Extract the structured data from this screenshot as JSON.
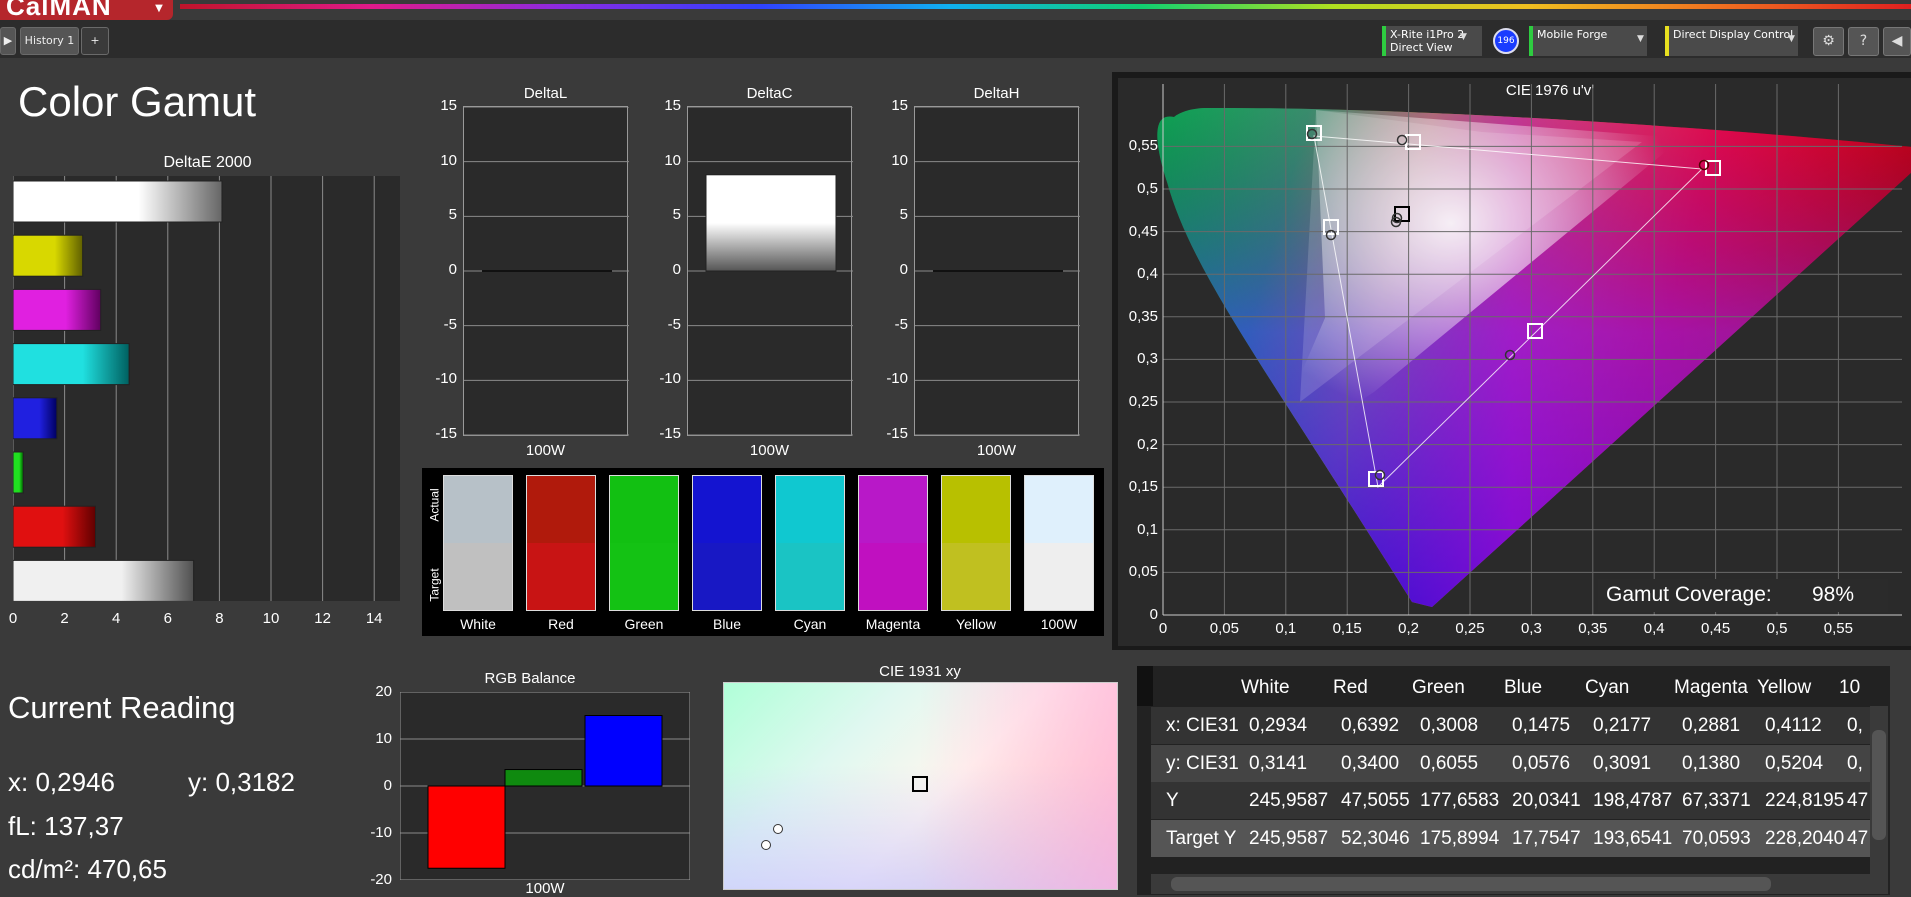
{
  "app": {
    "logo": "CalMAN",
    "logo_menu_icon": "chevron-down-icon"
  },
  "tabs": [
    {
      "label": "History 1"
    }
  ],
  "toolbar": {
    "meter_line1": "X-Rite i1Pro 2",
    "meter_line2": "Direct View",
    "meter_badge": "196",
    "source": "Mobile Forge",
    "display": "Direct Display Control"
  },
  "title": "Color Gamut",
  "deltae_chart": {
    "title": "DeltaE 2000",
    "ticks": [
      "0",
      "2",
      "4",
      "6",
      "8",
      "10",
      "12",
      "14"
    ]
  },
  "delta_charts": [
    {
      "title": "DeltaL",
      "xlabel": "100W"
    },
    {
      "title": "DeltaC",
      "xlabel": "100W"
    },
    {
      "title": "DeltaH",
      "xlabel": "100W"
    }
  ],
  "delta_ticks": [
    "15",
    "10",
    "5",
    "0",
    "-5",
    "-10",
    "-15"
  ],
  "swatches": {
    "actual_label": "Actual",
    "target_label": "Target",
    "items": [
      {
        "name": "White",
        "actual": "#b7c1c8",
        "target": "#c0c0c0"
      },
      {
        "name": "Red",
        "actual": "#b01a0c",
        "target": "#c81414"
      },
      {
        "name": "Green",
        "actual": "#12c012",
        "target": "#14c214"
      },
      {
        "name": "Blue",
        "actual": "#1414d0",
        "target": "#1818c4"
      },
      {
        "name": "Cyan",
        "actual": "#10c8d0",
        "target": "#1ac4c4"
      },
      {
        "name": "Magenta",
        "actual": "#b818c8",
        "target": "#c010c0"
      },
      {
        "name": "Yellow",
        "actual": "#b8c000",
        "target": "#c0c020"
      },
      {
        "name": "100W",
        "actual": "#dff0fc",
        "target": "#eeeeee"
      }
    ]
  },
  "cie1976": {
    "title": "CIE 1976 u'v'",
    "yticks": [
      "0,55",
      "0,5",
      "0,45",
      "0,4",
      "0,35",
      "0,3",
      "0,25",
      "0,2",
      "0,15",
      "0,1",
      "0,05",
      "0"
    ],
    "xticks": [
      "0",
      "0,05",
      "0,1",
      "0,15",
      "0,2",
      "0,25",
      "0,3",
      "0,35",
      "0,4",
      "0,45",
      "0,5",
      "0,55"
    ],
    "coverage_label": "Gamut Coverage:",
    "coverage_value": "98%"
  },
  "current_reading": {
    "title": "Current Reading",
    "x": "x: 0,2946",
    "y": "y: 0,3182",
    "fl": "fL: 137,37",
    "cdm2": "cd/m²: 470,65"
  },
  "rgb_balance": {
    "title": "RGB Balance",
    "ticks": [
      "20",
      "10",
      "0",
      "-10",
      "-20"
    ],
    "xlabel": "100W",
    "chart_data": {
      "type": "bar",
      "categories": [
        "Red",
        "Green",
        "Blue"
      ],
      "values": [
        -17.5,
        3.5,
        15
      ],
      "ylim": [
        -20,
        20
      ],
      "colors": [
        "#ff0000",
        "#0f8a0f",
        "#0000ff"
      ]
    }
  },
  "cie1931": {
    "title": "CIE 1931 xy"
  },
  "table": {
    "columns": [
      "",
      "White",
      "Red",
      "Green",
      "Blue",
      "Cyan",
      "Magenta",
      "Yellow",
      "10"
    ],
    "rows": [
      [
        "x: CIE31",
        "0,2934",
        "0,6392",
        "0,3008",
        "0,1475",
        "0,2177",
        "0,2881",
        "0,4112",
        "0,"
      ],
      [
        "y: CIE31",
        "0,3141",
        "0,3400",
        "0,6055",
        "0,0576",
        "0,3091",
        "0,1380",
        "0,5204",
        "0,"
      ],
      [
        "Y",
        "245,9587",
        "47,5055",
        "177,6583",
        "20,0341",
        "198,4787",
        "67,3371",
        "224,8195",
        "47"
      ],
      [
        "Target Y",
        "245,9587",
        "52,3046",
        "175,8994",
        "17,7547",
        "193,6541",
        "70,0593",
        "228,2040",
        "47"
      ]
    ]
  },
  "deltae_chart_data": {
    "type": "bar",
    "categories": [
      "100W",
      "Yellow",
      "Magenta",
      "Cyan",
      "Blue",
      "Green",
      "Red",
      "White"
    ],
    "values": [
      8.1,
      2.7,
      3.4,
      4.5,
      1.7,
      0.4,
      3.2,
      7.0
    ],
    "xlim": [
      0,
      15
    ]
  },
  "deltac_chart_data": {
    "type": "bar",
    "categories": [
      "100W"
    ],
    "values": [
      8.8
    ],
    "ylim": [
      -15,
      15
    ]
  }
}
